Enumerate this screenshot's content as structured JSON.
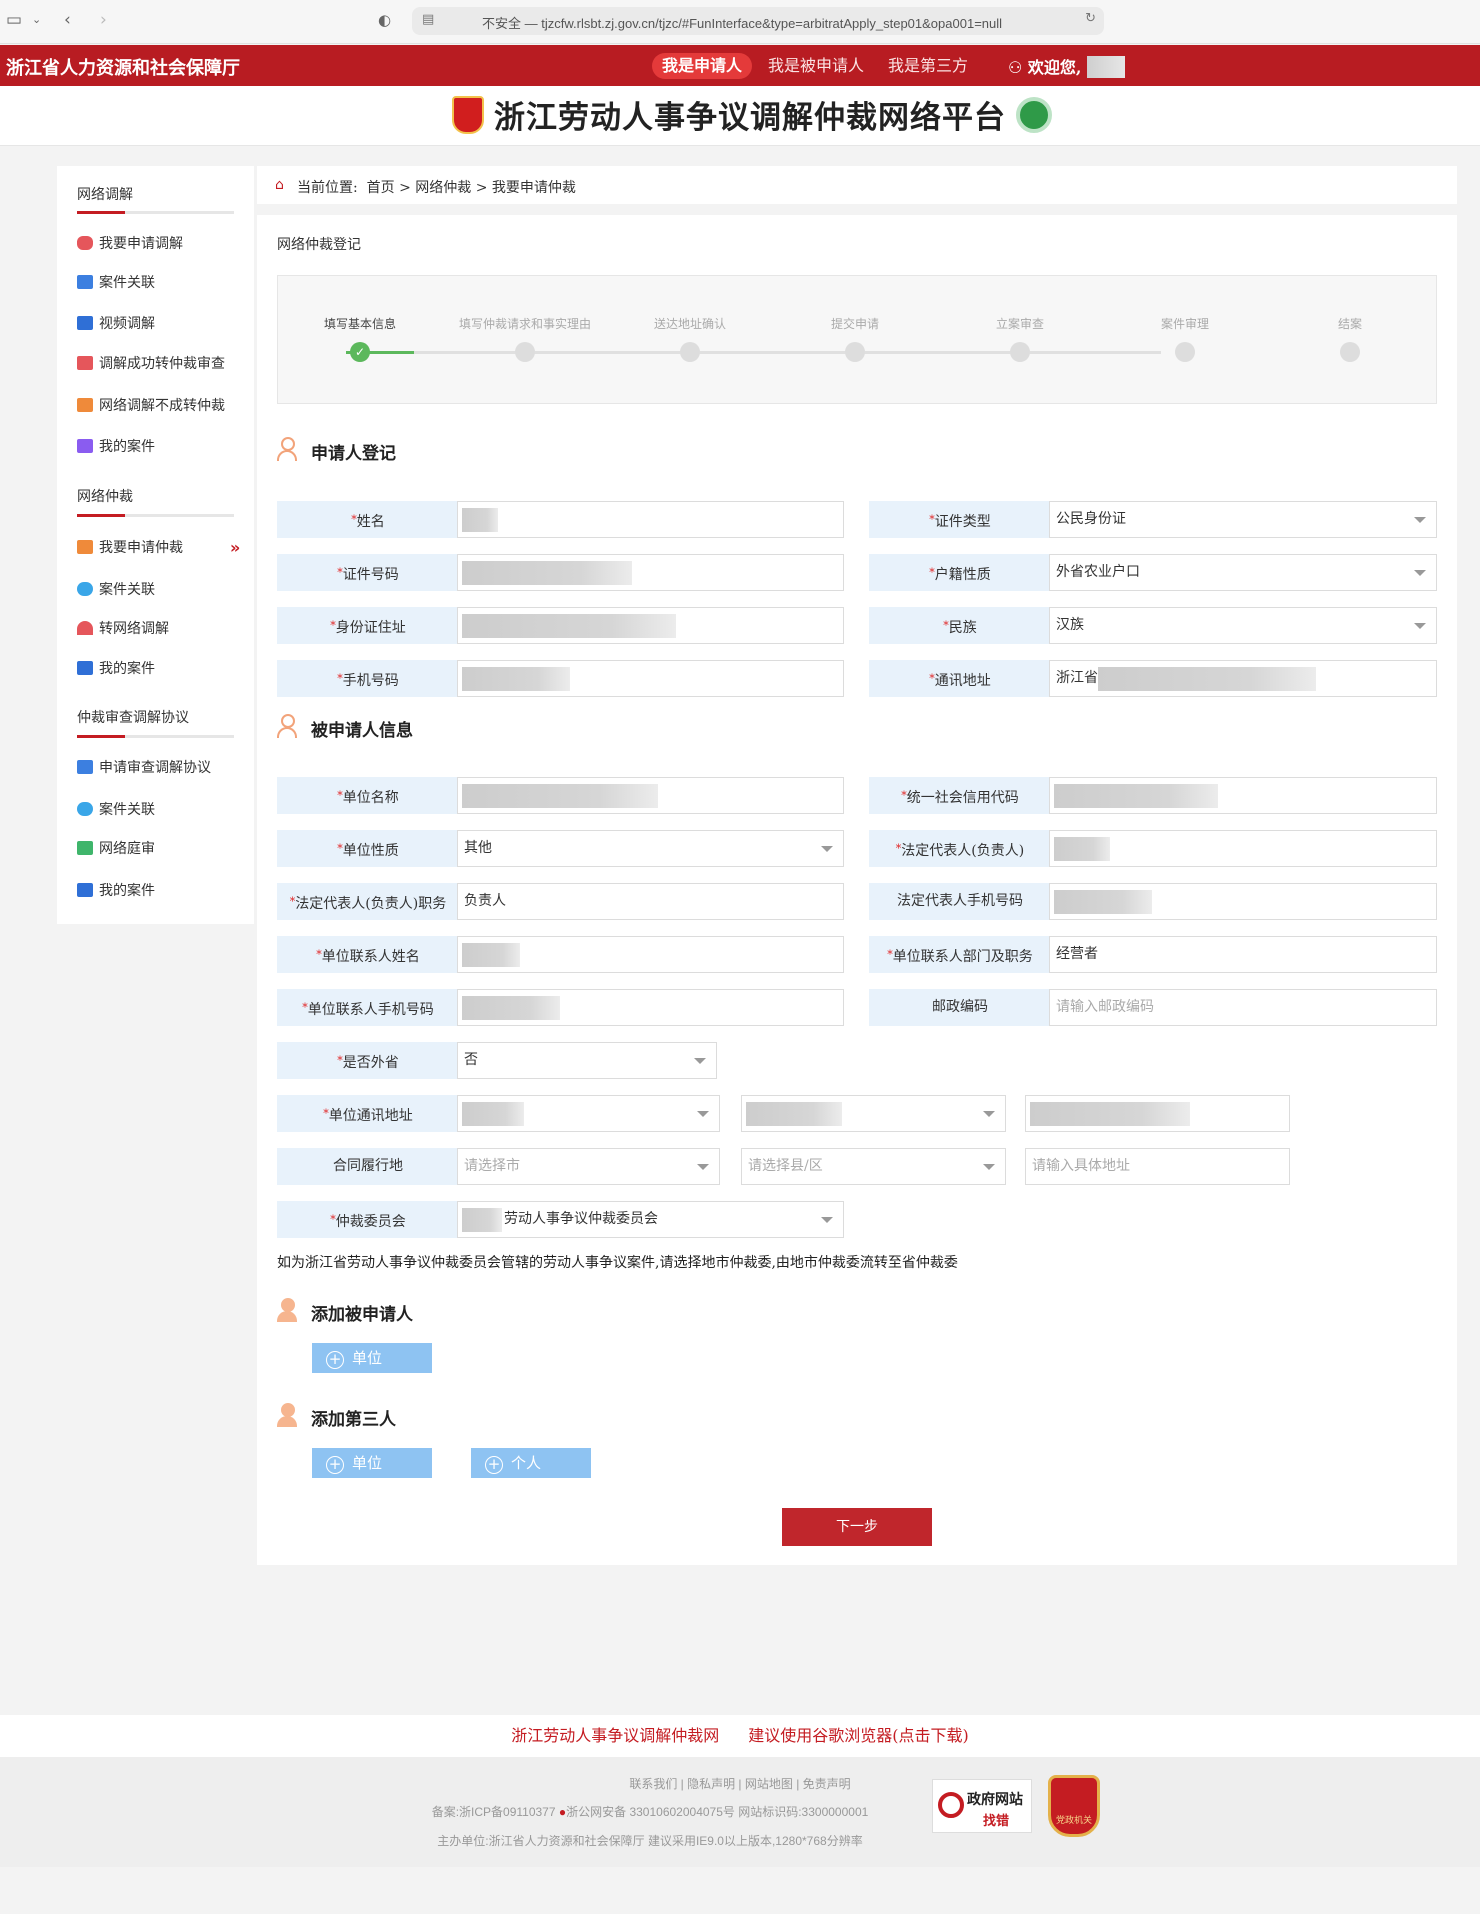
{
  "browser": {
    "url": "不安全 — tjzcfw.rlsbt.zj.gov.cn/tjzc/#FunInterface&type=arbitratApply_step01&opa001=null"
  },
  "header": {
    "site_title": "浙江省人力资源和社会保障厅",
    "roles": [
      "我是申请人",
      "我是被申请人",
      "我是第三方"
    ],
    "welcome": "欢迎您,",
    "platform_title": "浙江劳动人事争议调解仲裁网络平台"
  },
  "sidebar": {
    "groups": [
      {
        "title": "网络调解",
        "items": [
          "我要申请调解",
          "案件关联",
          "视频调解",
          "调解成功转仲裁审查",
          "网络调解不成转仲裁",
          "我的案件"
        ]
      },
      {
        "title": "网络仲裁",
        "items": [
          "我要申请仲裁",
          "案件关联",
          "转网络调解",
          "我的案件"
        ]
      },
      {
        "title": "仲裁审查调解协议",
        "items": [
          "申请审查调解协议",
          "案件关联",
          "网络庭审",
          "我的案件"
        ]
      }
    ]
  },
  "breadcrumb": {
    "prefix": "当前位置:",
    "path": "首页 > 网络仲裁 > 我要申请仲裁"
  },
  "form": {
    "heading": "网络仲裁登记",
    "steps": [
      "填写基本信息",
      "填写仲裁请求和事实理由",
      "送达地址确认",
      "提交申请",
      "立案审查",
      "案件审理",
      "结案"
    ],
    "applicant": {
      "title": "申请人登记",
      "name_label": "姓名",
      "idtype_label": "证件类型",
      "idtype_value": "公民身份证",
      "idno_label": "证件号码",
      "hukou_label": "户籍性质",
      "hukou_value": "外省农业户口",
      "idaddr_label": "身份证住址",
      "ethnic_label": "民族",
      "ethnic_value": "汉族",
      "phone_label": "手机号码",
      "mailaddr_label": "通讯地址",
      "mailaddr_value": "浙江省"
    },
    "respondent": {
      "title": "被申请人信息",
      "unitname_label": "单位名称",
      "creditcode_label": "统一社会信用代码",
      "unittype_label": "单位性质",
      "unittype_value": "其他",
      "legalrep_label": "法定代表人(负责人)",
      "legalrep_post_label": "法定代表人(负责人)职务",
      "legalrep_post_value": "负责人",
      "legalrep_phone_label": "法定代表人手机号码",
      "contact_name_label": "单位联系人姓名",
      "contact_dept_label": "单位联系人部门及职务",
      "contact_dept_value": "经营者",
      "contact_phone_label": "单位联系人手机号码",
      "postcode_label": "邮政编码",
      "postcode_placeholder": "请输入邮政编码",
      "outprov_label": "是否外省",
      "outprov_value": "否",
      "unitaddr_label": "单位通讯地址",
      "contractplace_label": "合同履行地",
      "city_placeholder": "请选择市",
      "county_placeholder": "请选择县/区",
      "addr_placeholder": "请输入具体地址",
      "committee_label": "仲裁委员会",
      "committee_value": "劳动人事争议仲裁委员会"
    },
    "note": "如为浙江省劳动人事争议仲裁委员会管辖的劳动人事争议案件,请选择地市仲裁委,由地市仲裁委流转至省仲裁委",
    "add_respondent": {
      "title": "添加被申请人",
      "btn_unit": "单位"
    },
    "add_third": {
      "title": "添加第三人",
      "btn_unit": "单位",
      "btn_person": "个人"
    },
    "next": "下一步"
  },
  "footer": {
    "links": [
      "浙江劳动人事争议调解仲裁网",
      "建议使用谷歌浏览器(点击下载)"
    ],
    "nav": "联系我们 | 隐私声明 | 网站地图 | 免责声明",
    "beian": "备案:浙ICP备09110377",
    "gongan": "浙公网安备 33010602004075号 网站标识码:3300000001",
    "host": "主办单位:浙江省人力资源和社会保障厅 建议采用IE9.0以上版本,1280*768分辨率",
    "gov_badge_1": "政府网站",
    "gov_badge_2": "找错",
    "party_badge": "党政机关"
  },
  "colors": {
    "brand_red": "#b81c22",
    "label_bg": "#e8f2fb",
    "step_done": "#5cb85c",
    "add_btn": "#8ec3f2"
  }
}
